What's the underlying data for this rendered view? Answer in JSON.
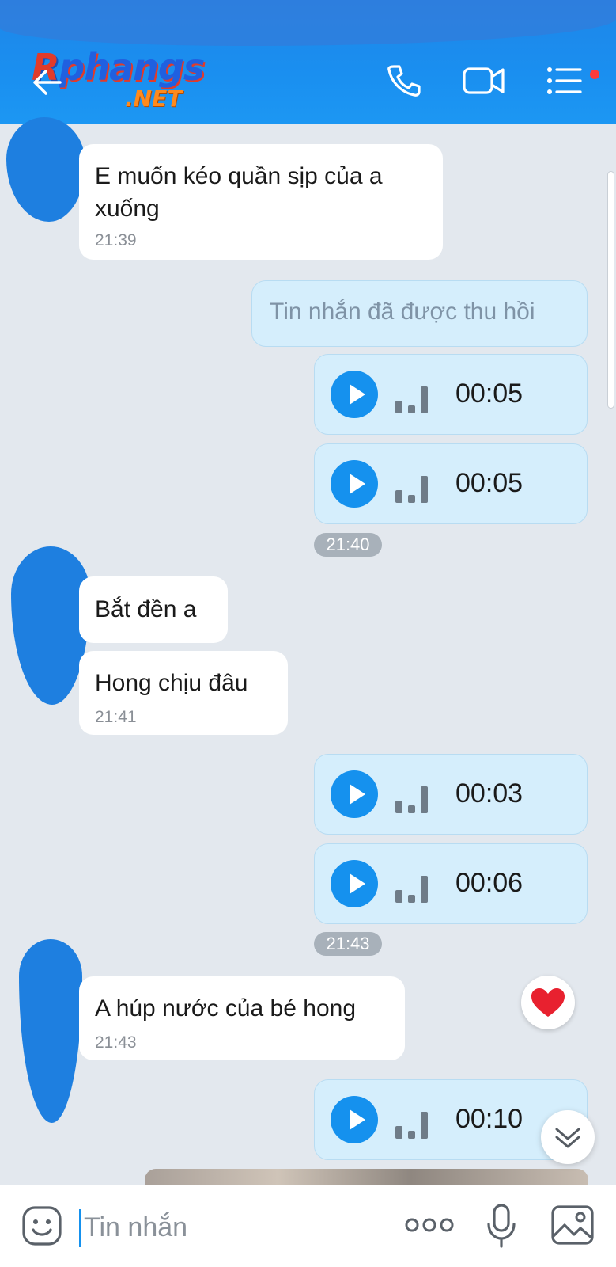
{
  "header": {
    "logo_main_r": "R",
    "logo_main_rest": "phangs",
    "logo_sub": ".NET",
    "icons": [
      "back-arrow-icon",
      "phone-icon",
      "video-call-icon",
      "menu-icon"
    ],
    "notification_dot_color": "#ff3b3b"
  },
  "messages": [
    {
      "dir": "in",
      "type": "text",
      "lines": [
        "E muốn kéo quần sịp của a",
        "xuống"
      ],
      "time": "21:39"
    },
    {
      "dir": "out",
      "type": "recalled",
      "text": "Tin nhắn đã được thu hồi"
    },
    {
      "dir": "out",
      "type": "voice",
      "duration": "00:05"
    },
    {
      "dir": "out",
      "type": "voice",
      "duration": "00:05"
    },
    {
      "type": "time-pill",
      "text": "21:40"
    },
    {
      "dir": "in",
      "type": "text",
      "lines": [
        "Bắt đền a"
      ]
    },
    {
      "dir": "in",
      "type": "text",
      "lines": [
        "Hong chịu đâu"
      ],
      "time": "21:41"
    },
    {
      "dir": "out",
      "type": "voice",
      "duration": "00:03"
    },
    {
      "dir": "out",
      "type": "voice",
      "duration": "00:06"
    },
    {
      "type": "time-pill",
      "text": "21:43"
    },
    {
      "dir": "in",
      "type": "text",
      "lines": [
        "A húp nước của bé hong"
      ],
      "time": "21:43",
      "reaction": "heart-icon"
    },
    {
      "dir": "out",
      "type": "voice",
      "duration": "00:10"
    }
  ],
  "composer": {
    "placeholder": "Tin nhắn",
    "icons": [
      "sticker-icon",
      "more-icon",
      "microphone-icon",
      "image-icon"
    ]
  },
  "colors": {
    "header": "#1a8ff0",
    "incoming_bubble": "#ffffff",
    "outgoing_bubble": "#d5eefc",
    "play_button": "#1591ee",
    "background": "#e3e8ee"
  }
}
